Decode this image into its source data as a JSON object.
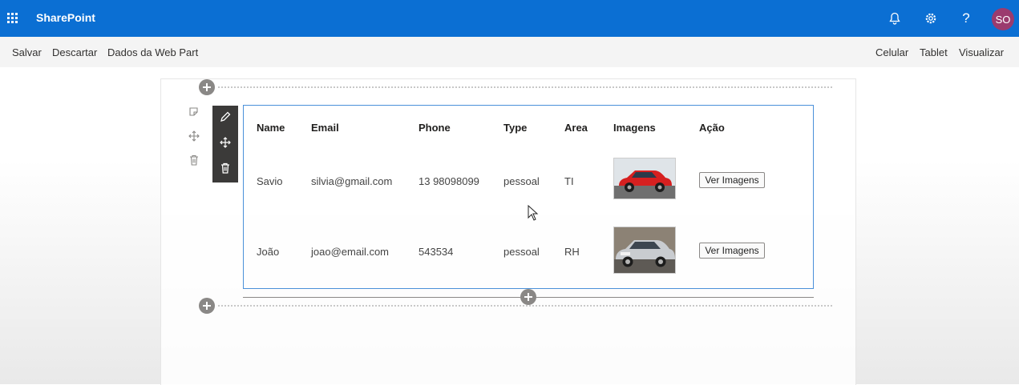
{
  "suite_bar": {
    "brand": "SharePoint",
    "avatar_initials": "SO",
    "help_glyph": "?",
    "icons": [
      "waffle-icon",
      "bell-icon",
      "settings-icon",
      "help-icon"
    ],
    "background": "#0b6fd3"
  },
  "command_bar": {
    "left": [
      "Salvar",
      "Descartar",
      "Dados da Web Part"
    ],
    "right": [
      "Celular",
      "Tablet",
      "Visualizar"
    ]
  },
  "webpart_toolbar": {
    "icons": [
      "edit-icon",
      "move-icon",
      "delete-icon"
    ]
  },
  "section_toolbar": {
    "icons": [
      "edit-section-icon",
      "move-section-icon",
      "delete-section-icon"
    ]
  },
  "table": {
    "columns": [
      "Name",
      "Email",
      "Phone",
      "Type",
      "Area",
      "Imagens",
      "Ação"
    ],
    "rows": [
      {
        "name": "Savio",
        "email": "silvia@gmail.com",
        "phone": "13 98098099",
        "type": "pessoal",
        "area": "TI",
        "image": "red-car-photo",
        "action": "Ver Imagens"
      },
      {
        "name": "João",
        "email": "joao@email.com",
        "phone": "543534",
        "type": "pessoal",
        "area": "RH",
        "image": "silver-car-photo",
        "action": "Ver Imagens"
      }
    ]
  }
}
